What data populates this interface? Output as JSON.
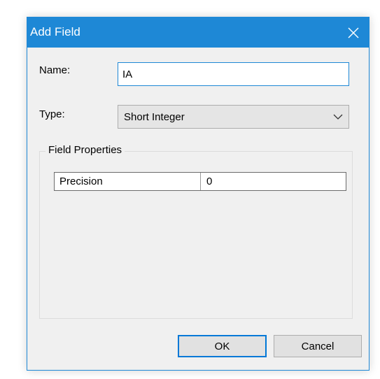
{
  "window": {
    "title": "Add Field",
    "close_icon": "close-icon"
  },
  "colors": {
    "title_bar": "#1e88d6",
    "dialog_bg": "#f0f0f0",
    "focus_border": "#0078d7"
  },
  "form": {
    "name_label": "Name:",
    "name_value": "IA",
    "type_label": "Type:",
    "type_selected": "Short Integer",
    "type_dropdown_icon": "chevron-down-icon"
  },
  "field_properties": {
    "legend": "Field Properties",
    "rows": [
      {
        "name": "Precision",
        "value": "0"
      }
    ]
  },
  "buttons": {
    "ok_label": "OK",
    "cancel_label": "Cancel"
  }
}
